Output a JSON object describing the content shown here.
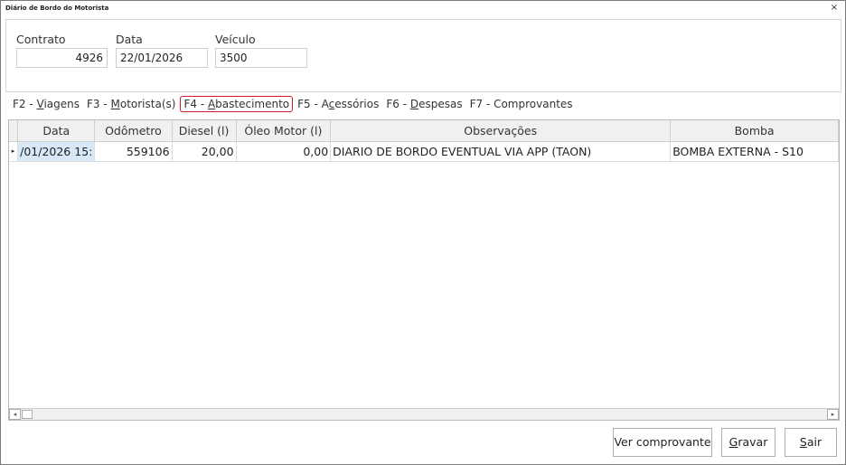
{
  "window": {
    "title": "Diário de Bordo do Motorista",
    "close_glyph": "×"
  },
  "header": {
    "contrato_label": "Contrato",
    "contrato_value": "4926",
    "data_label": "Data",
    "data_value": "22/01/2026",
    "veiculo_label": "Veículo",
    "veiculo_value": "3500"
  },
  "tabs": [
    {
      "prefix": "F2 - ",
      "mnemonic": "V",
      "rest": "iagens",
      "active": false
    },
    {
      "prefix": "F3 - ",
      "mnemonic": "M",
      "rest": "otorista(s)",
      "active": false
    },
    {
      "prefix": "F4 - ",
      "mnemonic": "A",
      "rest": "bastecimento",
      "active": true
    },
    {
      "prefix": "F5 - A",
      "mnemonic": "c",
      "rest": "essórios",
      "active": false
    },
    {
      "prefix": "F6 - ",
      "mnemonic": "D",
      "rest": "espesas",
      "active": false
    },
    {
      "prefix": "F7 - Comprovantes",
      "mnemonic": "",
      "rest": "",
      "active": false
    }
  ],
  "grid": {
    "columns": [
      "Data",
      "Odômetro",
      "Diesel (l)",
      "Óleo Motor (l)",
      "Observações",
      "Bomba"
    ],
    "rows": [
      {
        "indicator": "▸",
        "data": "/01/2026 15:",
        "odometro": "559106",
        "diesel": "20,00",
        "oleo": "0,00",
        "observacoes": "DIARIO DE BORDO EVENTUAL VIA APP (TAON)",
        "bomba": "BOMBA EXTERNA - S10"
      }
    ],
    "scroll_left_glyph": "◂",
    "scroll_right_glyph": "▸"
  },
  "buttons": {
    "ver_comprovante": "Ver comprovante",
    "gravar_mnemonic": "G",
    "gravar_rest": "ravar",
    "sair_mnemonic": "S",
    "sair_rest": "air"
  }
}
